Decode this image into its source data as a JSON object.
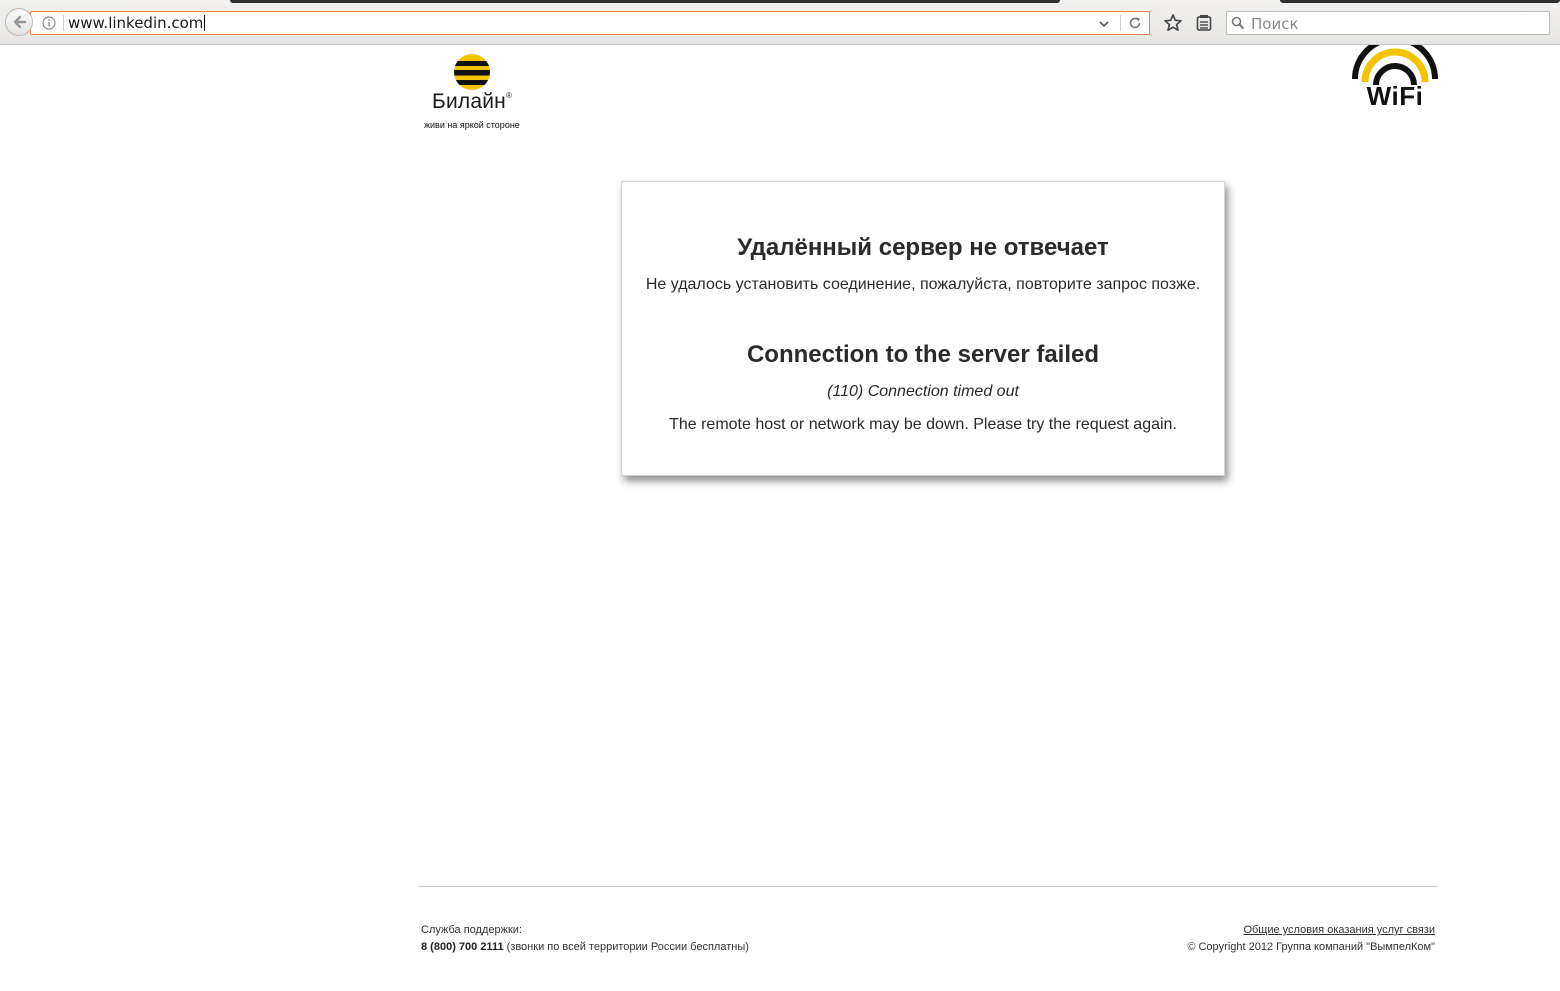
{
  "browser": {
    "url": "www.linkedin.com",
    "search_placeholder": "Поиск"
  },
  "logos": {
    "beeline_brand": "Билайн",
    "beeline_registered": "®",
    "beeline_slogan": "живи на яркой стороне",
    "wifi_text": "WiFi",
    "colors": {
      "yellow": "#f5c400",
      "black": "#111111"
    }
  },
  "error": {
    "title_ru": "Удалённый сервер не отвечает",
    "text_ru": "Не удалось установить соединение, пожалуйста, повторите запрос позже.",
    "title_en": "Connection to the server failed",
    "code": "(110) Connection timed out",
    "text_en": "The remote host or network may be down. Please try the request again."
  },
  "footer": {
    "support_label": "Служба поддержки:",
    "phone": "8 (800) 700 2111",
    "phone_note": " (звонки по всей территории России бесплатны)",
    "terms_link": "Общие условия оказания услуг связи",
    "copyright": "© Copyright 2012 Группа компаний \"ВымпелКом\""
  }
}
